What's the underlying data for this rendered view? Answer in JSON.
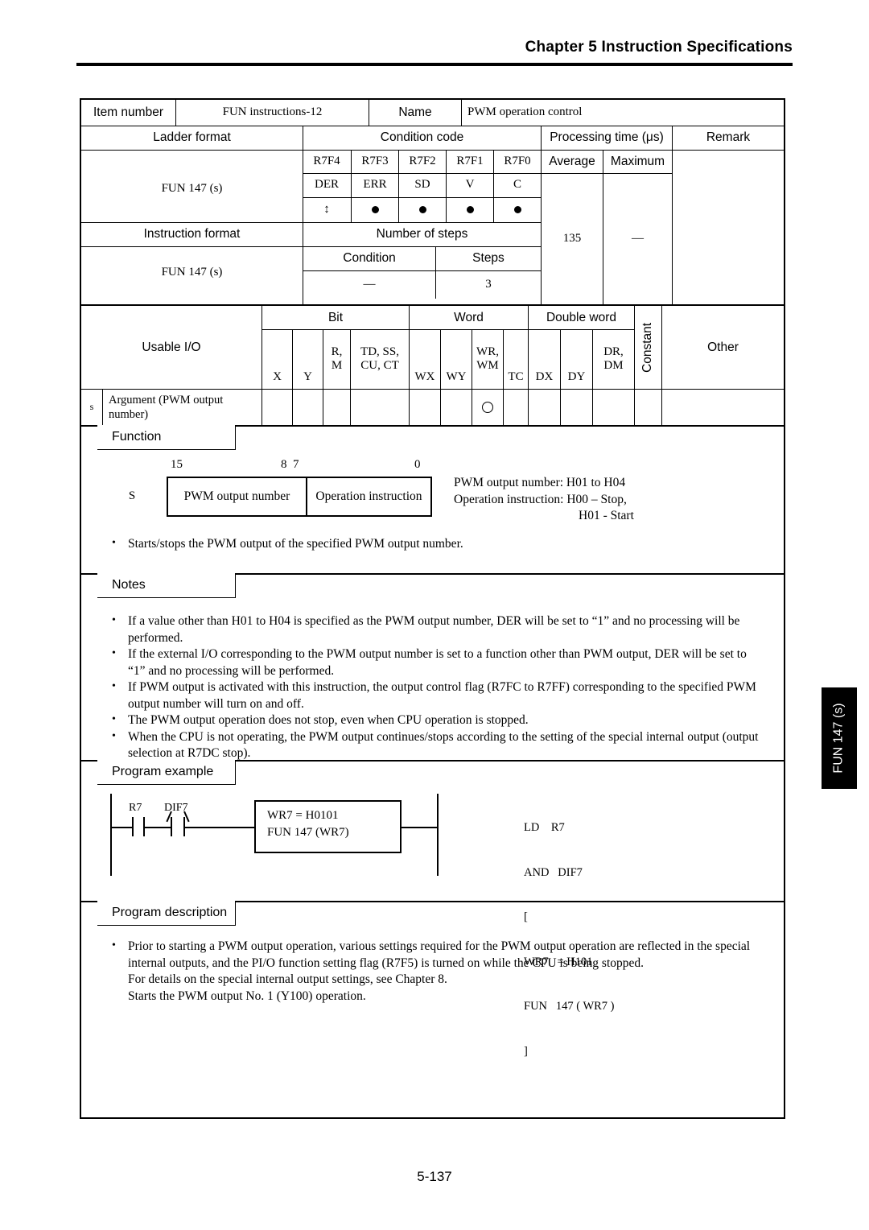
{
  "page": {
    "chapter_header": "Chapter 5  Instruction Specifications",
    "page_number": "5-137",
    "side_tab": "FUN 147 (s)"
  },
  "identity": {
    "item_number_label": "Item number",
    "item_number_value": "FUN instructions-12",
    "name_label": "Name",
    "name_value": "PWM operation control"
  },
  "spec_table": {
    "ladder_format_label": "Ladder format",
    "condition_code_label": "Condition code",
    "processing_time_label": "Processing time (μs)",
    "remark_label": "Remark",
    "ladder_format_value": "FUN 147 (s)",
    "condition_registers": [
      "R7F4",
      "R7F3",
      "R7F2",
      "R7F1",
      "R7F0"
    ],
    "condition_names": [
      "DER",
      "ERR",
      "SD",
      "V",
      "C"
    ],
    "condition_marks": [
      "updown",
      "dot",
      "dot",
      "dot",
      "dot"
    ],
    "average_label": "Average",
    "maximum_label": "Maximum",
    "average_value": "135",
    "maximum_value": "—",
    "remark_value": "",
    "instruction_format_label": "Instruction format",
    "number_of_steps_label": "Number of steps",
    "condition_label": "Condition",
    "steps_label": "Steps",
    "instruction_format_value": "FUN 147 (s)",
    "condition_value": "—",
    "steps_value": "3"
  },
  "usable_io": {
    "label": "Usable I/O",
    "group_bit": "Bit",
    "group_word": "Word",
    "group_double_word": "Double word",
    "group_constant": "Constant",
    "group_other": "Other",
    "columns": [
      {
        "key": "X",
        "line1": "",
        "line2": "X"
      },
      {
        "key": "Y",
        "line1": "",
        "line2": "Y"
      },
      {
        "key": "RM",
        "line1": "R,",
        "line2": "M"
      },
      {
        "key": "TDSS",
        "line1": "TD, SS,",
        "line2": "CU, CT"
      },
      {
        "key": "WX",
        "line1": "",
        "line2": "WX"
      },
      {
        "key": "WY",
        "line1": "",
        "line2": "WY"
      },
      {
        "key": "WRWM",
        "line1": "WR,",
        "line2": "WM"
      },
      {
        "key": "TC",
        "line1": "",
        "line2": "TC"
      },
      {
        "key": "DX",
        "line1": "",
        "line2": "DX"
      },
      {
        "key": "DY",
        "line1": "",
        "line2": "DY"
      },
      {
        "key": "DRDM",
        "line1": "DR,",
        "line2": "DM"
      }
    ],
    "rows": [
      {
        "operand": "s",
        "description": "Argument (PWM output number)",
        "marks": [
          "",
          "",
          "",
          "",
          "",
          "",
          "O",
          "",
          "",
          "",
          ""
        ],
        "constant": "",
        "other": ""
      }
    ]
  },
  "function": {
    "section_label": "Function",
    "bit_labels": {
      "msb": "15",
      "mid_left": "8",
      "mid_right": "7",
      "lsb": "0"
    },
    "operand_label": "S",
    "field_high": "PWM output number",
    "field_low": "Operation instruction",
    "legend": [
      "PWM output number:  H01 to H04",
      "Operation instruction:  H00 – Stop,",
      "H01 - Start"
    ],
    "bullets": [
      "Starts/stops the PWM output of the specified PWM output number."
    ]
  },
  "notes": {
    "section_label": "Notes",
    "bullets": [
      "If a value other than H01 to H04 is specified as the PWM output number, DER will be set to “1” and no processing will be performed.",
      "If the external I/O corresponding to the PWM output number is set to a function other than PWM output, DER will be set to “1” and no processing will be performed.",
      "If PWM output is activated with this instruction, the output control flag (R7FC to R7FF) corresponding to the specified PWM output number will turn on and off.",
      "The PWM output operation does not stop, even when CPU operation is stopped.",
      "When the CPU is not operating, the PWM output continues/stops according to the setting of the special internal output (output selection at R7DC stop)."
    ]
  },
  "program_example": {
    "section_label": "Program example",
    "ladder": {
      "contact1_label": "R7",
      "contact2_label": "DIF7",
      "function_block_line1": "WR7 = H0101",
      "function_block_line2": "FUN 147 (WR7)"
    },
    "mnemonic_lines": [
      "LD    R7",
      "AND   DIF7",
      "[",
      "WR7   = H101",
      "FUN   147 ( WR7 )",
      "]"
    ]
  },
  "program_description": {
    "section_label": "Program description",
    "bullets": [
      "Prior to starting a PWM output operation, various settings required for the PWM output operation are reflected in the special internal outputs, and the PI/O function setting flag (R7F5) is turned on while the CPU is being stopped.\nFor details on the special internal output settings, see Chapter 8.\nStarts the PWM output No. 1 (Y100) operation."
    ]
  }
}
